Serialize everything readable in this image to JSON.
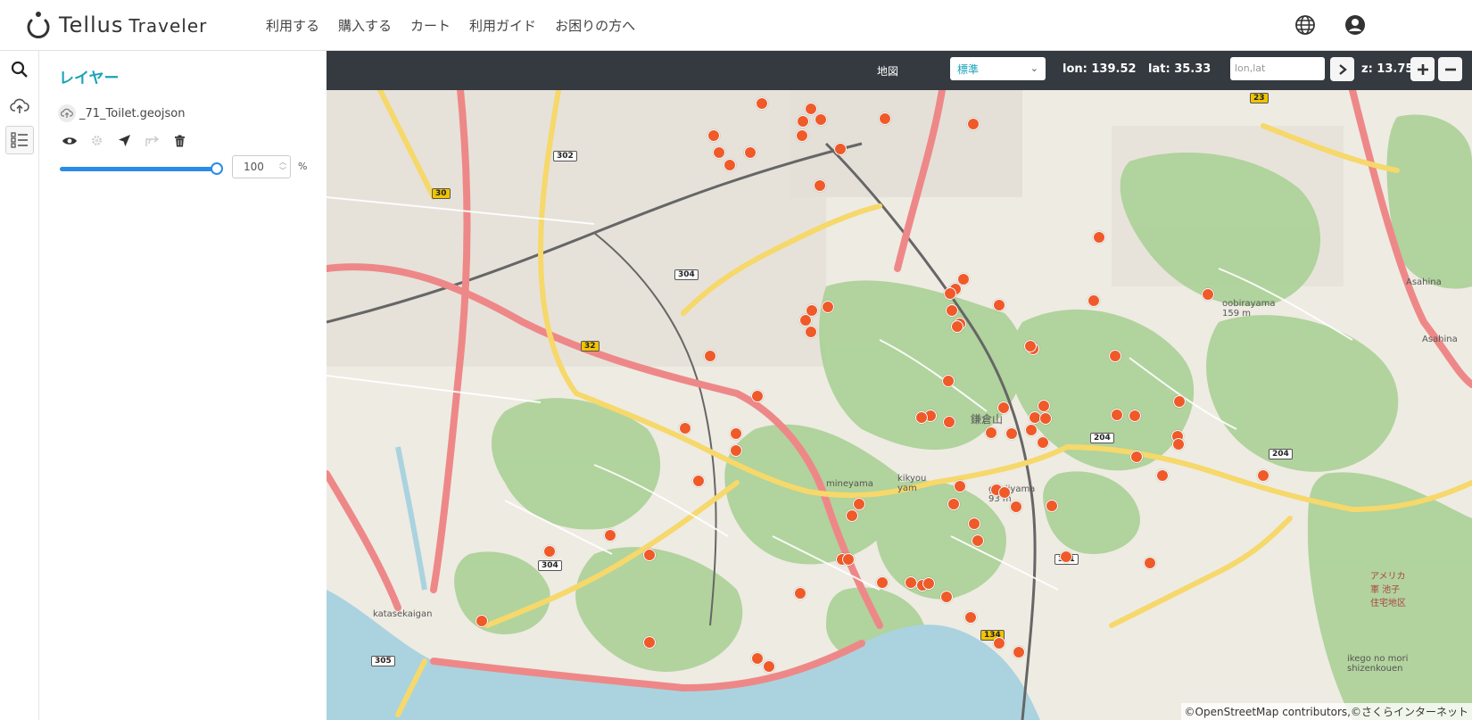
{
  "app": {
    "name": "Tellus",
    "sub": "Traveler"
  },
  "nav": [
    "利用する",
    "購入する",
    "カート",
    "利用ガイド",
    "お困りの方へ"
  ],
  "header_icons": [
    "globe-icon",
    "account-circle-icon"
  ],
  "rail": [
    "search-icon",
    "cloud-upload-icon",
    "layer-list-icon"
  ],
  "panel": {
    "title": "レイヤー",
    "layer_name": "_71_Toilet.geojson",
    "tools": [
      "eye-icon",
      "gear-icon",
      "navigate-icon",
      "share-icon",
      "trash-icon"
    ],
    "opacity": 100,
    "opacity_unit": "%"
  },
  "toolbar": {
    "map_label": "地図",
    "map_select": "標準",
    "lon_label": "lon:",
    "lon": "139.52",
    "lat_label": "lat:",
    "lat": "35.33",
    "coord_placeholder": "lon,lat",
    "zoom_label": "z:",
    "zoom": "13.75"
  },
  "map": {
    "labels": [
      "鎌倉山",
      "mineyama",
      "kikyou yam",
      "genjiyama 93 m",
      "katasekaigan",
      "oobirayama 159 m",
      "ikego no mori shizenkouen",
      "アメリカ 軍 池子 住宅地区",
      "Asahina",
      "Asahina"
    ],
    "routes": [
      "302",
      "30",
      "304",
      "32",
      "304",
      "204",
      "204",
      "311",
      "134",
      "305",
      "23"
    ],
    "attribution": "©OpenStreetMap contributors,©さくらインターネット"
  },
  "marker_count": 86
}
